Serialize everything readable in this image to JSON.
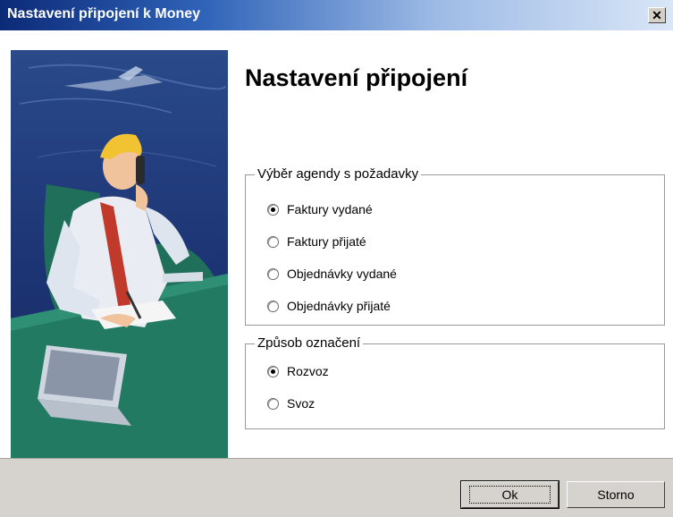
{
  "window": {
    "title": "Nastavení připojení k Money",
    "close_icon": "close-icon",
    "title_gradient": [
      "#0c2a78",
      "#d9e6f6"
    ]
  },
  "header": {
    "heading": "Nastavení připojení"
  },
  "agenda_group": {
    "legend": "Výběr agendy s požadavky",
    "options": [
      {
        "label": "Faktury vydané",
        "checked": true
      },
      {
        "label": "Faktury přijaté",
        "checked": false
      },
      {
        "label": "Objednávky vydané",
        "checked": false
      },
      {
        "label": "Objednávky přijaté",
        "checked": false
      }
    ]
  },
  "marking_group": {
    "legend": "Způsob  označení",
    "options": [
      {
        "label": "Rozvoz",
        "checked": true
      },
      {
        "label": "Svoz",
        "checked": false
      }
    ]
  },
  "buttons": {
    "ok": "Ok",
    "cancel": "Storno"
  },
  "colors": {
    "illustration_bg": "#1b2f6b",
    "footer_bg": "#d6d3ce",
    "accent_tie": "#c0392b"
  }
}
